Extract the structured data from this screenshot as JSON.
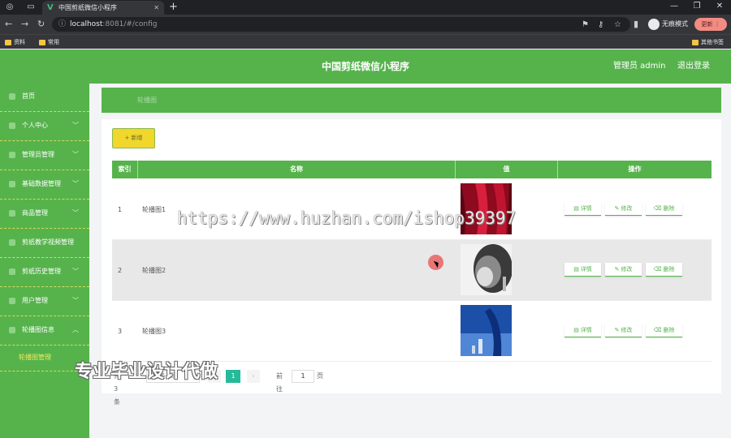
{
  "browser": {
    "tab_title": "中国剪纸微信小程序",
    "url_host": "localhost",
    "url_path": ":8081/#/config",
    "incognito_label": "无痕模式",
    "update_label": "更新",
    "bookmarks": [
      "资料",
      "常用"
    ],
    "other_bookmarks": "其他书签"
  },
  "header": {
    "title": "中国剪纸微信小程序",
    "admin": "管理员 admin",
    "logout": "退出登录"
  },
  "sidebar": {
    "items": [
      {
        "label": "首页",
        "has_chevron": false
      },
      {
        "label": "个人中心",
        "has_chevron": true
      },
      {
        "label": "管理员管理",
        "has_chevron": true
      },
      {
        "label": "基础数据管理",
        "has_chevron": true
      },
      {
        "label": "商品管理",
        "has_chevron": true
      },
      {
        "label": "剪纸教学视频管理",
        "has_chevron": false
      },
      {
        "label": "剪纸历史管理",
        "has_chevron": true
      },
      {
        "label": "用户管理",
        "has_chevron": true
      },
      {
        "label": "轮播图信息",
        "has_chevron": true
      }
    ],
    "submenu": "轮播图管理"
  },
  "breadcrumb": "轮播图",
  "toolbar": {
    "add_label": "+ 新增"
  },
  "table": {
    "headers": [
      "索引",
      "名称",
      "值",
      "操作"
    ],
    "rows": [
      {
        "index": "1",
        "name": "轮播图1",
        "image": "red-curtain"
      },
      {
        "index": "2",
        "name": "轮播图2",
        "image": "grey-bw"
      },
      {
        "index": "3",
        "name": "轮播图3",
        "image": "blue-sky"
      }
    ],
    "actions": {
      "detail": "详情",
      "edit": "修改",
      "delete": "删除"
    }
  },
  "pagination": {
    "total": "共 3 条",
    "page_size": "10条/页",
    "current": "1",
    "goto_label": "前往",
    "goto_value": "1",
    "page_unit": "页"
  },
  "watermarks": {
    "url": "https://www.huzhan.com/ishop39397",
    "ad": "专业毕业设计代做"
  },
  "colors": {
    "primary": "#56b34c",
    "accent_yellow": "#f1d62c",
    "pagination_active": "#26b99a"
  }
}
